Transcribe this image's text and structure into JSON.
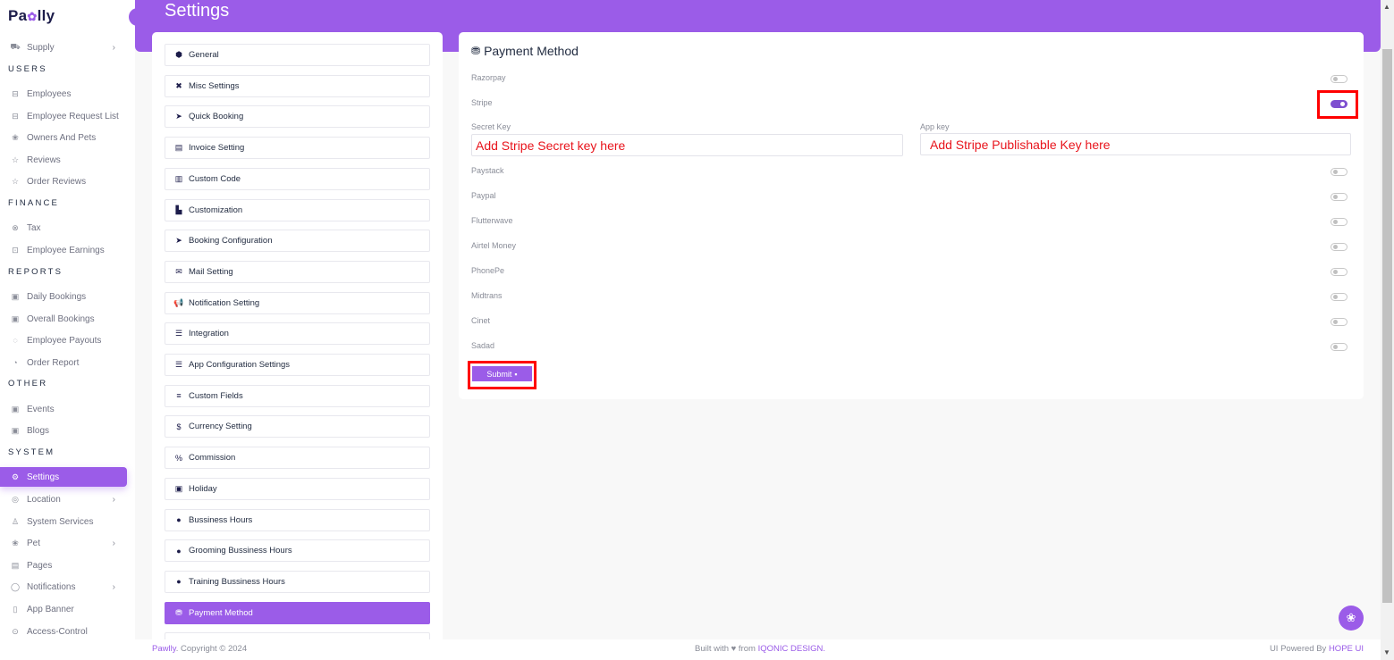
{
  "brand": {
    "logo_left": "Pa",
    "logo_paw": "✿",
    "logo_right": "lly"
  },
  "sidebar": {
    "items_top": [
      {
        "label": "Supply",
        "icon": "truck-icon",
        "glyph": "⛟",
        "chevron": true
      }
    ],
    "sections": [
      {
        "title": "USERS",
        "items": [
          {
            "label": "Employees",
            "icon": "briefcase-icon",
            "glyph": "⊟"
          },
          {
            "label": "Employee Request List",
            "icon": "briefcase-icon",
            "glyph": "⊟"
          },
          {
            "label": "Owners And Pets",
            "icon": "paw-icon",
            "glyph": "❀"
          },
          {
            "label": "Reviews",
            "icon": "star-icon",
            "glyph": "☆"
          },
          {
            "label": "Order Reviews",
            "icon": "star-icon",
            "glyph": "☆"
          }
        ]
      },
      {
        "title": "FINANCE",
        "items": [
          {
            "label": "Tax",
            "icon": "percent-circle-icon",
            "glyph": "⊗"
          },
          {
            "label": "Employee Earnings",
            "icon": "wallet-icon",
            "glyph": "⊡"
          }
        ]
      },
      {
        "title": "REPORTS",
        "items": [
          {
            "label": "Daily Bookings",
            "icon": "calendar-icon",
            "glyph": "▣"
          },
          {
            "label": "Overall Bookings",
            "icon": "calendar-icon",
            "glyph": "▣"
          },
          {
            "label": "Employee Payouts",
            "icon": "payout-icon",
            "glyph": "◌"
          },
          {
            "label": "Order Report",
            "icon": "pie-chart-icon",
            "glyph": "◔"
          }
        ]
      },
      {
        "title": "OTHER",
        "items": [
          {
            "label": "Events",
            "icon": "calendar-icon",
            "glyph": "▣"
          },
          {
            "label": "Blogs",
            "icon": "calendar-icon",
            "glyph": "▣"
          }
        ]
      },
      {
        "title": "SYSTEM",
        "items": [
          {
            "label": "Settings",
            "icon": "gear-icon",
            "glyph": "⚙",
            "active": true
          },
          {
            "label": "Location",
            "icon": "location-pin-icon",
            "glyph": "◎",
            "chevron": true
          },
          {
            "label": "System Services",
            "icon": "user-service-icon",
            "glyph": "♙"
          },
          {
            "label": "Pet",
            "icon": "paw-icon",
            "glyph": "❀",
            "chevron": true
          },
          {
            "label": "Pages",
            "icon": "page-icon",
            "glyph": "▤"
          },
          {
            "label": "Notifications",
            "icon": "bell-icon",
            "glyph": "◯",
            "chevron": true
          },
          {
            "label": "App Banner",
            "icon": "mobile-icon",
            "glyph": "▯"
          },
          {
            "label": "Access-Control",
            "icon": "shield-icon",
            "glyph": "⊙"
          }
        ]
      }
    ]
  },
  "header": {
    "title": "Settings"
  },
  "settings_menu": [
    {
      "label": "General",
      "icon": "cube-icon",
      "glyph": "⬢"
    },
    {
      "label": "Misc Settings",
      "icon": "tools-icon",
      "glyph": "✖"
    },
    {
      "label": "Quick Booking",
      "icon": "paper-plane-icon",
      "glyph": "➤"
    },
    {
      "label": "Invoice Setting",
      "icon": "invoice-icon",
      "glyph": "▤"
    },
    {
      "label": "Custom Code",
      "icon": "code-file-icon",
      "glyph": "▥"
    },
    {
      "label": "Customization",
      "icon": "customize-icon",
      "glyph": "▙"
    },
    {
      "label": "Booking Configuration",
      "icon": "paper-plane-icon",
      "glyph": "➤"
    },
    {
      "label": "Mail Setting",
      "icon": "envelope-icon",
      "glyph": "✉"
    },
    {
      "label": "Notification Setting",
      "icon": "megaphone-icon",
      "glyph": "📢"
    },
    {
      "label": "Integration",
      "icon": "sliders-icon",
      "glyph": "☰"
    },
    {
      "label": "App Configuration Settings",
      "icon": "sliders-icon",
      "glyph": "☰"
    },
    {
      "label": "Custom Fields",
      "icon": "list-icon",
      "glyph": "≡"
    },
    {
      "label": "Currency Setting",
      "icon": "dollar-icon",
      "glyph": "$"
    },
    {
      "label": "Commission",
      "icon": "percent-icon",
      "glyph": "%"
    },
    {
      "label": "Holiday",
      "icon": "calendar-check-icon",
      "glyph": "▣"
    },
    {
      "label": "Bussiness Hours",
      "icon": "clock-icon",
      "glyph": "●"
    },
    {
      "label": "Grooming Bussiness Hours",
      "icon": "clock-icon",
      "glyph": "●"
    },
    {
      "label": "Training Bussiness Hours",
      "icon": "clock-icon",
      "glyph": "●"
    },
    {
      "label": "Payment Method",
      "icon": "coins-icon",
      "glyph": "⛃",
      "active": true
    },
    {
      "label": "",
      "icon": "",
      "glyph": ""
    }
  ],
  "payment": {
    "title": "Payment Method",
    "gateways_top": [
      {
        "name": "Razorpay",
        "enabled": false
      },
      {
        "name": "Stripe",
        "enabled": true
      }
    ],
    "stripe_fields": {
      "secret_label": "Secret Key",
      "secret_value": "Add Stripe Secret key here",
      "app_label": "App key",
      "app_value": "Add Stripe Publishable Key here"
    },
    "gateways_bottom": [
      {
        "name": "Paystack",
        "enabled": false
      },
      {
        "name": "Paypal",
        "enabled": false
      },
      {
        "name": "Flutterwave",
        "enabled": false
      },
      {
        "name": "Airtel Money",
        "enabled": false
      },
      {
        "name": "PhonePe",
        "enabled": false
      },
      {
        "name": "Midtrans",
        "enabled": false
      },
      {
        "name": "Cinet",
        "enabled": false
      },
      {
        "name": "Sadad",
        "enabled": false
      }
    ],
    "submit_label": "Submit",
    "submit_icon": "💾"
  },
  "footer": {
    "brand": "Pawlly",
    "copyright": ". Copyright © 2024",
    "built_prefix": "Built with ♥ from ",
    "built_brand": "IQONIC DESIGN.",
    "powered_prefix": "UI Powered By ",
    "powered_brand": "HOPE UI"
  },
  "colors": {
    "accent": "#9b5ce8",
    "highlight": "#ff0000",
    "annotation_text": "#e8141c"
  }
}
